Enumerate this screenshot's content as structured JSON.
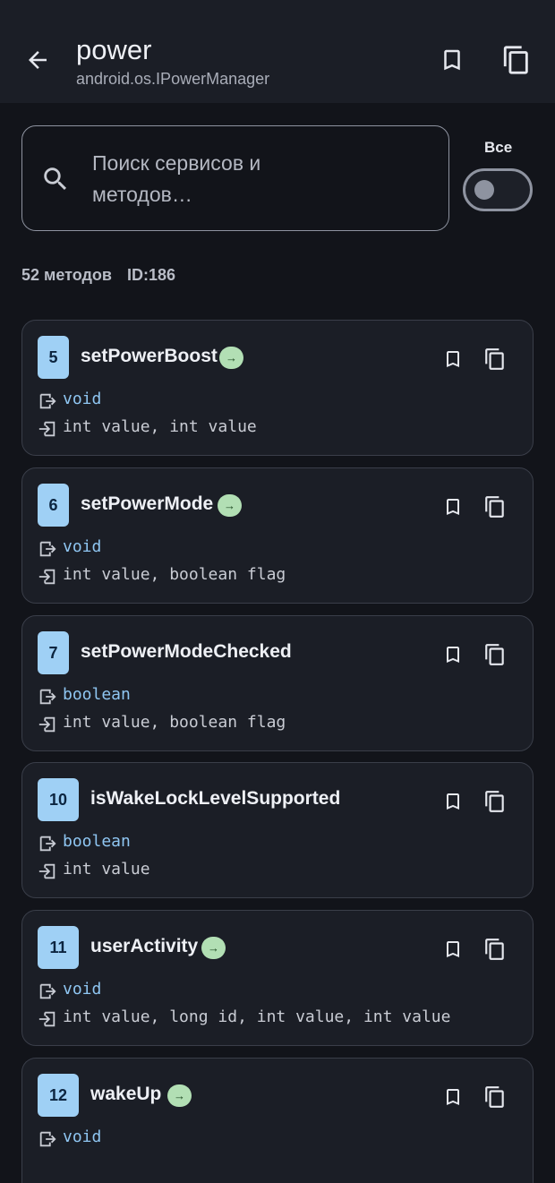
{
  "header": {
    "title": "power",
    "subtitle": "android.os.IPowerManager"
  },
  "search": {
    "placeholder": "Поиск сервисов и методов…"
  },
  "toggle": {
    "label": "Все",
    "on": false
  },
  "summary": {
    "methods": "52 методов",
    "id": "ID:186"
  },
  "badge_glyph": "→",
  "methods": [
    {
      "index": "5",
      "name": "setPowerBoost",
      "badge": true,
      "return_type": "void",
      "params": "int value, int value"
    },
    {
      "index": "6",
      "name": "setPowerMode",
      "badge": true,
      "return_type": "void",
      "params": "int value, boolean flag"
    },
    {
      "index": "7",
      "name": "setPowerModeChecked",
      "badge": false,
      "return_type": "boolean",
      "params": "int value, boolean flag"
    },
    {
      "index": "10",
      "name": "isWakeLockLevelSupported",
      "badge": false,
      "return_type": "boolean",
      "params": "int value"
    },
    {
      "index": "11",
      "name": "userActivity",
      "badge": true,
      "return_type": "void",
      "params": "int value, long id, int value, int value"
    },
    {
      "index": "12",
      "name": "wakeUp",
      "badge": true,
      "return_type": "void",
      "params": ""
    }
  ],
  "colors": {
    "background": "#12141a",
    "surface": "#1b1e26",
    "index_chip": "#9fd0f5",
    "return_type": "#8fc6f2",
    "badge": "#b2dfb4"
  }
}
